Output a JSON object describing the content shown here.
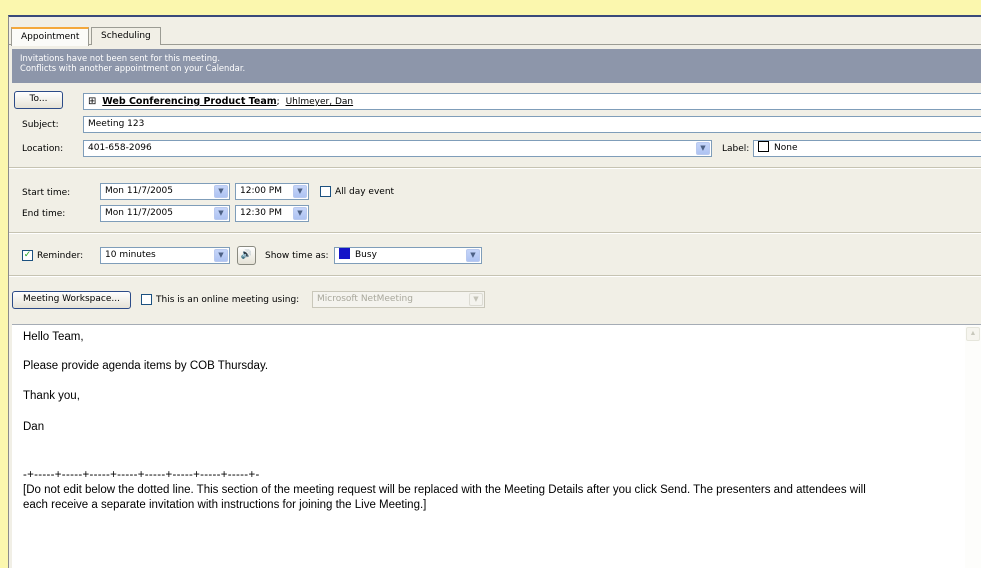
{
  "tabs": [
    {
      "label": "Appointment",
      "active": true
    },
    {
      "label": "Scheduling",
      "active": false
    }
  ],
  "infobar": {
    "line1": "Invitations have not been sent for this meeting.",
    "line2": "Conflicts with another appointment on your Calendar."
  },
  "to": {
    "button_label": "To...",
    "expand_glyph": "⊞",
    "group_name": "Web Conferencing Product Team",
    "separator": ";",
    "attendee": "Uhlmeyer, Dan"
  },
  "subject": {
    "label": "Subject:",
    "value": "Meeting 123"
  },
  "location": {
    "label": "Location:",
    "value": "401-658-2096"
  },
  "label_field": {
    "label": "Label:",
    "value": "None",
    "swatch_color": "#ffffff"
  },
  "start": {
    "label": "Start time:",
    "date": "Mon 11/7/2005",
    "time": "12:00 PM"
  },
  "end": {
    "label": "End time:",
    "date": "Mon 11/7/2005",
    "time": "12:30 PM"
  },
  "all_day": {
    "label": "All day event",
    "checked": false
  },
  "reminder": {
    "label": "Reminder:",
    "checked": true,
    "value": "10 minutes",
    "sound_icon": "speaker-icon"
  },
  "show_time_as": {
    "label": "Show time as:",
    "value": "Busy",
    "swatch_color": "#1414c8"
  },
  "workspace": {
    "button_label": "Meeting Workspace..."
  },
  "online": {
    "label": "This is an online meeting using:",
    "checked": false,
    "value": "Microsoft NetMeeting"
  },
  "body": {
    "greeting": "Hello Team,",
    "line1": "Please provide agenda items by COB Thursday.",
    "line2": "Thank you,",
    "signature": "Dan",
    "divider": "-+-----+-----+-----+-----+-----+-----+-----+-----+-",
    "notice_line1": "[Do not edit below the dotted line. This section of the meeting request will be replaced with the Meeting Details after you click Send. The presenters and attendees will",
    "notice_line2": "each receive a separate invitation with instructions for joining the Live Meeting.]"
  },
  "colors": {
    "infobar": "#8d96aa",
    "tab_accent": "#f4a83b",
    "outer_background": "#fbf7ae"
  }
}
